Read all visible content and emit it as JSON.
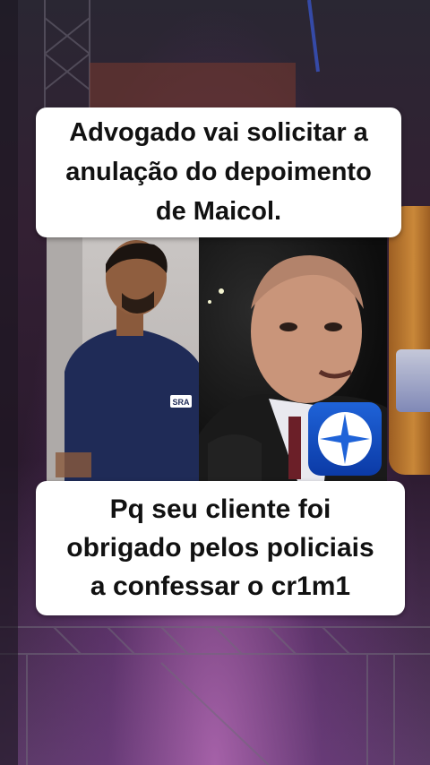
{
  "top_caption": {
    "lines": [
      "Advogado  vai  solicitar a",
      "anulação do depoimento",
      "de Maicol."
    ]
  },
  "bottom_caption": {
    "lines": [
      "Pq seu cliente foi",
      "obrigado pelos policiais",
      "a confessar o cr1m1"
    ]
  },
  "colors": {
    "caption_bg": "#ffffff",
    "caption_text": "#111111",
    "shirt": "#1f2b57",
    "tv_logo": "#1f63d8"
  },
  "icons": {
    "shirt_logo": "sra-logo-icon",
    "tv_logo": "tv-network-logo-icon"
  }
}
